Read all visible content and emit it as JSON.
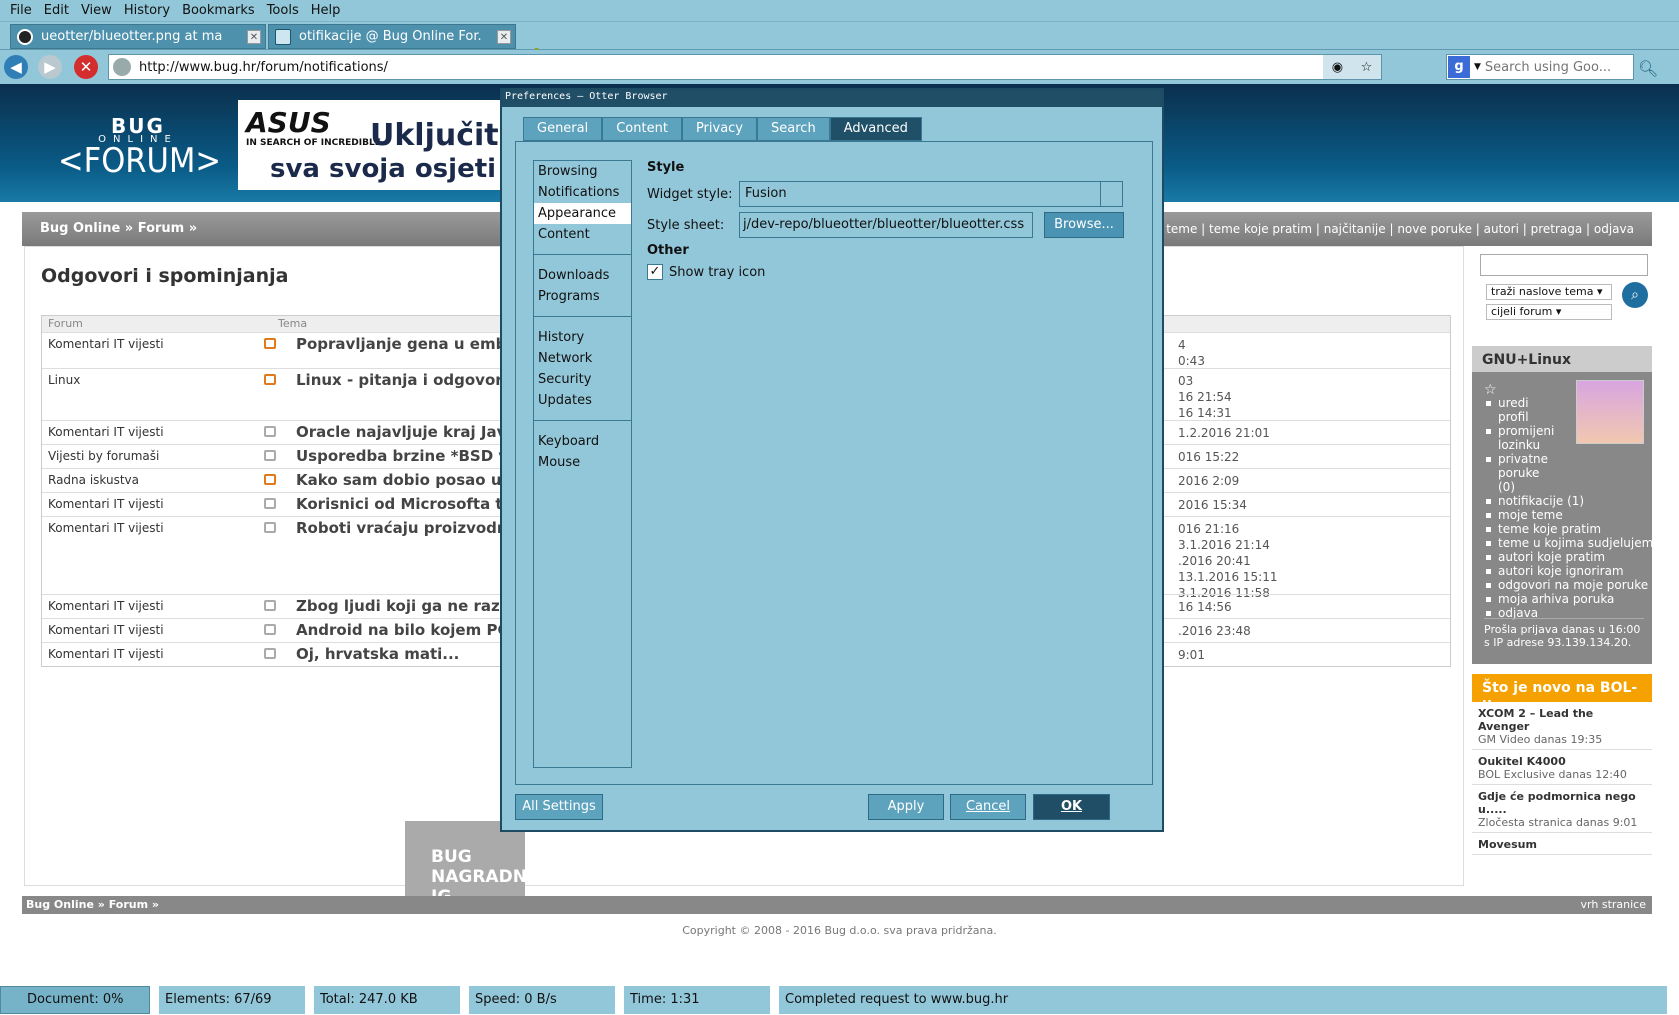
{
  "menubar": {
    "items": [
      "File",
      "Edit",
      "View",
      "History",
      "Bookmarks",
      "Tools",
      "Help"
    ]
  },
  "tabs": [
    {
      "label": "ueotter/blueotter.png at ma",
      "icon": "github-icon"
    },
    {
      "label": "otifikacije @ Bug Online For.",
      "icon": "document-icon"
    }
  ],
  "newtab": "+",
  "nav": {
    "url": "http://www.bug.hr/forum/notifications/",
    "search_placeholder": "Search using Goo..."
  },
  "site": {
    "logo": {
      "l1": "BUG",
      "l2": "ONLINE",
      "l3": "<FORUM>"
    },
    "banner": {
      "brand": "ASUS",
      "tagline": "IN SEARCH OF INCREDIBLE",
      "t1": "Uključit",
      "t2": "sva svoja osjeti"
    },
    "breadcrumb": "Bug Online » Forum »",
    "toplinks": "vne teme | teme koje pratim | najčitanije | nove poruke | autori | pretraga | odjava",
    "heading": "Odgovori i spominjanja",
    "columns": {
      "forum": "Forum",
      "topic": "Tema"
    },
    "rows": [
      {
        "forum": "Komentari IT vijesti",
        "topic": "Popravljanje gena u embr",
        "date": "4\n0:43",
        "new": true
      },
      {
        "forum": "Linux",
        "topic": "Linux - pitanja i odgovori",
        "date": "03\n16 21:54\n16 14:31",
        "new": true
      },
      {
        "forum": "Komentari IT vijesti",
        "topic": "Oracle najavljuje kraj Java",
        "date": "1.2.2016 21:01",
        "new": false
      },
      {
        "forum": "Vijesti by forumaši",
        "topic": "Usporedba brzine *BSD vs",
        "date": "016 15:22",
        "new": false
      },
      {
        "forum": "Radna iskustva",
        "topic": "Kako sam dobio posao u I",
        "date": "2016 2:09",
        "new": true
      },
      {
        "forum": "Komentari IT vijesti",
        "topic": "Korisnici od Microsofta tra",
        "date": "2016 15:34",
        "new": false
      },
      {
        "forum": "Komentari IT vijesti",
        "topic": "Roboti vraćaju proizvodnj",
        "date": "016 21:16\n3.1.2016 21:14\n.2016 20:41\n13.1.2016 15:11\n3.1.2016 11:58",
        "new": false
      },
      {
        "forum": "Komentari IT vijesti",
        "topic": "Zbog ljudi koji ga ne razur",
        "date": "16 14:56",
        "new": false
      },
      {
        "forum": "Komentari IT vijesti",
        "topic": "Android na bilo kojem PC-",
        "date": ".2016 23:48",
        "new": false
      },
      {
        "forum": "Komentari IT vijesti",
        "topic": "Oj, hrvatska mati...",
        "date": "9:01",
        "new": false
      }
    ],
    "bottom_image": "BUG NAGRADNA IG",
    "sidebar": {
      "select1": "traži naslove tema",
      "select2": "cijeli forum",
      "username": "GNU+Linux",
      "star": "☆",
      "links": [
        "uredi profil",
        "promijeni lozinku",
        "privatne poruke (0)",
        "notifikacije (1)",
        "moje teme",
        "teme koje pratim",
        "teme u kojima sudjelujem",
        "autori koje pratim",
        "autori koje ignoriram",
        "odgovori na moje poruke",
        "moja arhiva poruka",
        "odjava"
      ],
      "last_login": "Prošla prijava danas u 16:00 s IP adrese 93.139.134.20.",
      "news_title": "Što je novo na BOL-u",
      "news": [
        {
          "title": "XCOM 2 – Lead the Avenger",
          "meta": "GM Video danas 19:35"
        },
        {
          "title": "Oukitel K4000",
          "meta": "BOL Exclusive danas 12:40"
        },
        {
          "title": "Gdje će podmornica nego u.....",
          "meta": "Zločesta stranica danas 9:01"
        },
        {
          "title": "Movesum",
          "meta": ""
        }
      ]
    },
    "footer_crumb": "Bug Online » Forum »",
    "footer_top": "vrh stranice",
    "copyright": "Copyright © 2008 - 2016 Bug d.o.o. sva prava pridržana."
  },
  "status": {
    "document": "Document: 0%",
    "elements": "Elements: 67/69",
    "total": "Total: 247.0 KB",
    "speed": "Speed: 0 B/s",
    "time": "Time: 1:31",
    "message": "Completed request to www.bug.hr"
  },
  "dialog": {
    "title": "Preferences — Otter Browser",
    "tabs": [
      "General",
      "Content",
      "Privacy",
      "Search",
      "Advanced"
    ],
    "active_tab": "Advanced",
    "categories": [
      [
        "Browsing",
        "Notifications",
        "Appearance",
        "Content"
      ],
      [
        "Downloads",
        "Programs"
      ],
      [
        "History",
        "Network",
        "Security",
        "Updates"
      ],
      [
        "Keyboard",
        "Mouse"
      ]
    ],
    "selected_category": "Appearance",
    "style_heading": "Style",
    "widget_style_label": "Widget style:",
    "widget_style_value": "Fusion",
    "stylesheet_label": "Style sheet:",
    "stylesheet_value": "j/dev-repo/blueotter/blueotter/blueotter.css",
    "browse": "Browse...",
    "other_heading": "Other",
    "tray_label": "Show tray icon",
    "tray_checked": true,
    "all_settings": "All Settings",
    "apply": "Apply",
    "cancel": "Cancel",
    "ok": "OK"
  },
  "colors": {
    "chrome": "#92c7d9",
    "dialog_dark": "#1f4e66",
    "accent": "#f5a100"
  }
}
